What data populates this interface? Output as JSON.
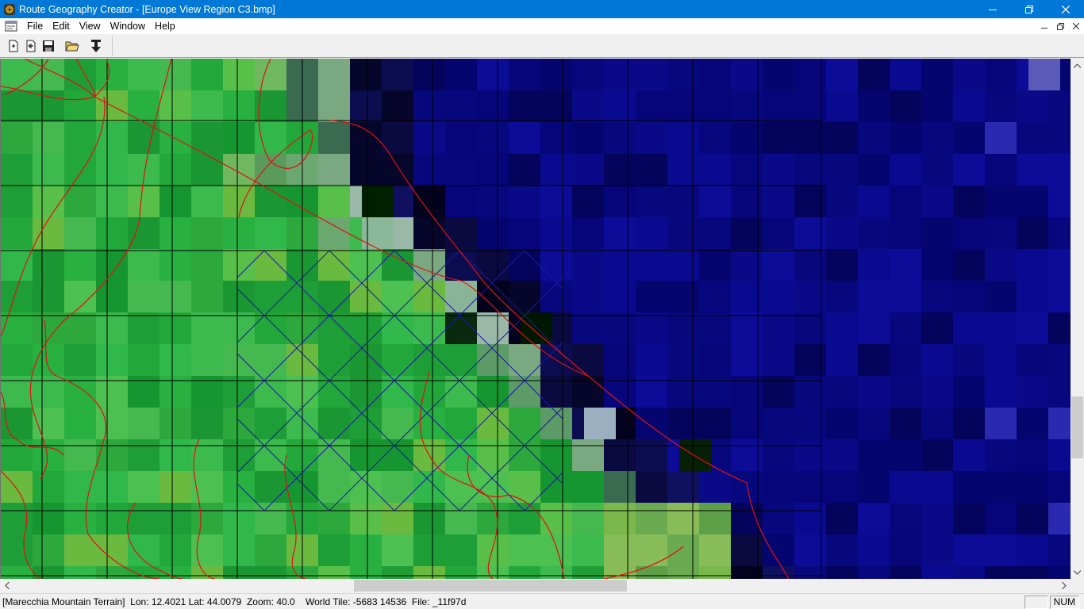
{
  "window": {
    "title": "Route Geography Creator - [Europe View Region C3.bmp]"
  },
  "menu": {
    "items": [
      "File",
      "Edit",
      "View",
      "Window",
      "Help"
    ]
  },
  "toolbar": {
    "buttons": [
      {
        "name": "new-button",
        "icon": "new-document-icon"
      },
      {
        "name": "add-button",
        "icon": "add-document-icon"
      },
      {
        "name": "save-button",
        "icon": "save-disk-icon"
      },
      {
        "name": "open-button",
        "icon": "open-folder-icon"
      },
      {
        "name": "import-button",
        "icon": "download-arrow-icon"
      }
    ]
  },
  "statusbar": {
    "text": "[Marecchia Mountain Terrain]  Lon: 12.4021 Lat: 44.0079  Zoom: 40.0    World Tile: -5683 14536  File: _11f97d",
    "pane_empty": "",
    "pane_num": "NUM"
  },
  "colors": {
    "titlebar": "#0078d7",
    "land": "#2aa83a",
    "sea": "#07078a",
    "rivers": "#e01010",
    "grid": "#000000",
    "selection": "#1a1aa0"
  }
}
